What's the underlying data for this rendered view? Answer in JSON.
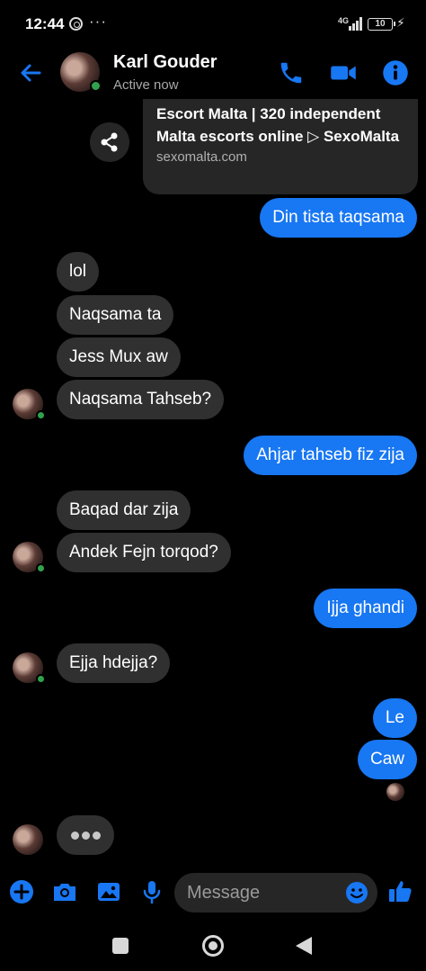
{
  "status_bar": {
    "time": "12:44",
    "dots": "···",
    "network": "4G",
    "battery": "10"
  },
  "header": {
    "name": "Karl Gouder",
    "status": "Active now",
    "back_icon": "arrow-left-icon",
    "call_icon": "phone-icon",
    "video_icon": "video-camera-icon",
    "info_icon": "info-icon"
  },
  "link_card": {
    "title": "Escort Malta | 320 independent Malta escorts online ▷ SexoMalta",
    "domain": "sexomalta.com"
  },
  "messages": [
    {
      "side": "out",
      "text": "Din tista taqsama"
    },
    {
      "side": "in",
      "text": "lol"
    },
    {
      "side": "in",
      "text": "Naqsama ta"
    },
    {
      "side": "in",
      "text": "Jess Mux aw"
    },
    {
      "side": "in",
      "text": "Naqsama Tahseb?"
    },
    {
      "side": "out",
      "text": "Ahjar tahseb fiz zija"
    },
    {
      "side": "in",
      "text": "Baqad dar zija"
    },
    {
      "side": "in",
      "text": "Andek Fejn torqod?"
    },
    {
      "side": "out",
      "text": "Ijja ghandi"
    },
    {
      "side": "in",
      "text": "Ejja hdejja?"
    },
    {
      "side": "out",
      "text": "Le"
    },
    {
      "side": "out",
      "text": "Caw"
    }
  ],
  "composer": {
    "placeholder": "Message",
    "icons": [
      "plus-icon",
      "camera-icon",
      "image-icon",
      "microphone-icon",
      "emoji-icon",
      "thumbs-up-icon"
    ]
  },
  "colors": {
    "accent": "#1877f2",
    "incoming_bubble": "#303030",
    "background": "#000000",
    "online": "#31a24c"
  }
}
